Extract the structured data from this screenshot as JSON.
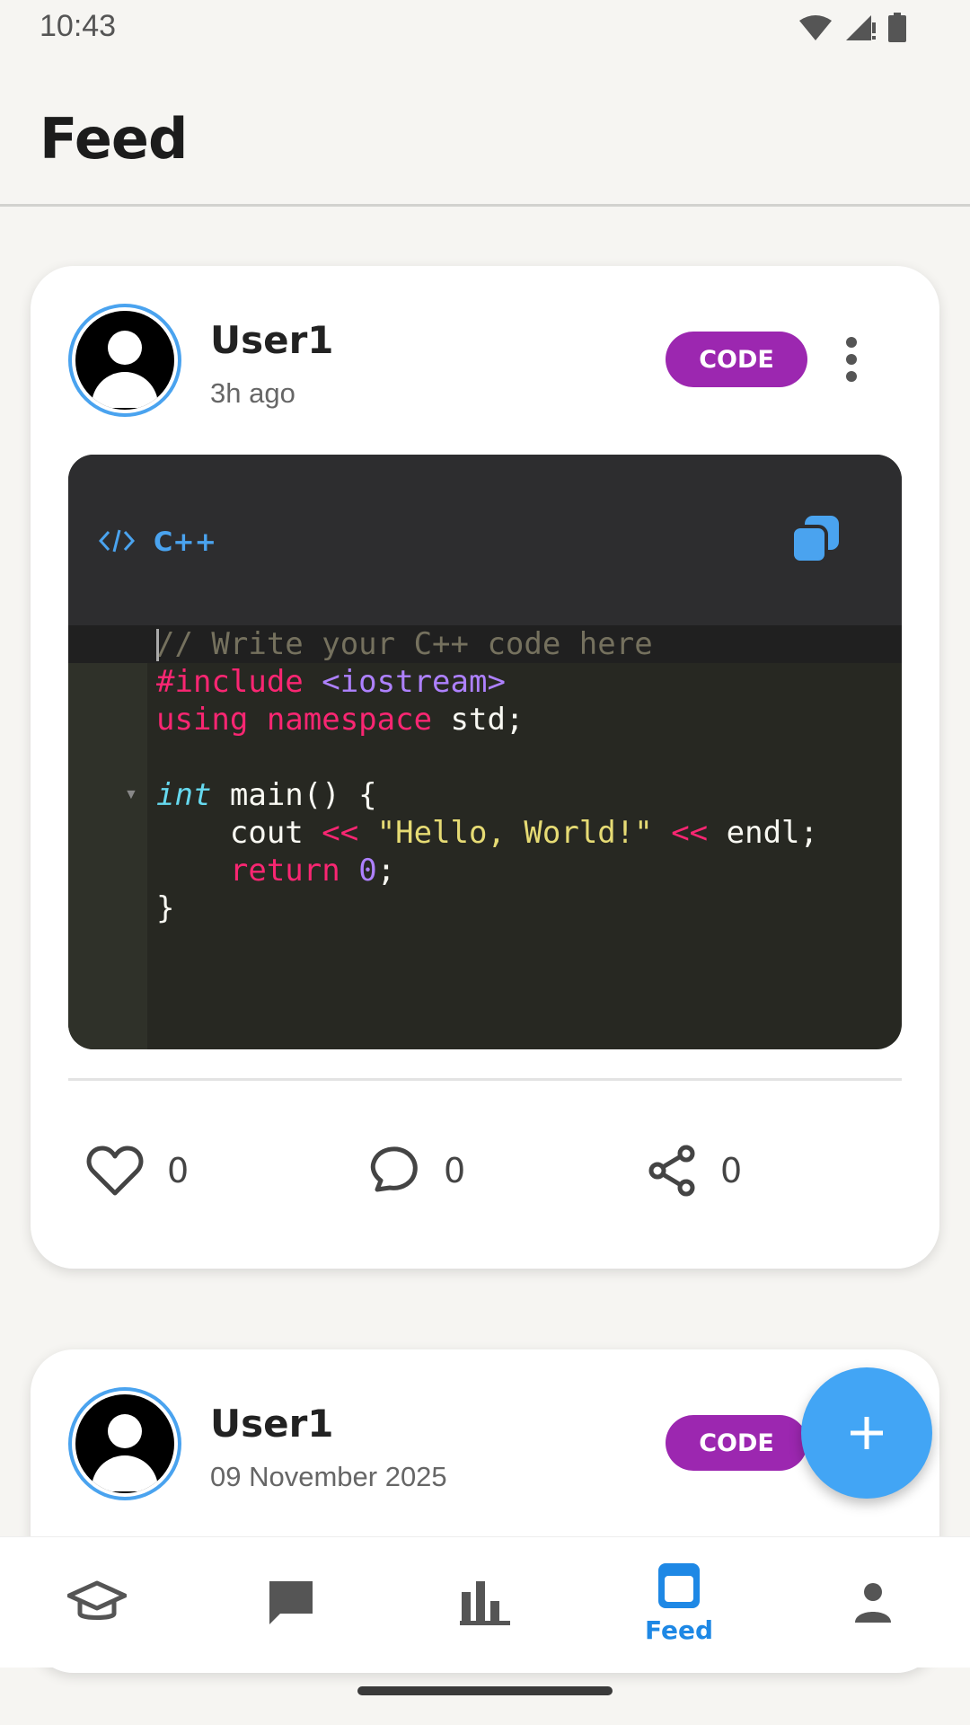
{
  "status_bar": {
    "time": "10:43",
    "icons": [
      "wifi-icon",
      "signal-icon",
      "battery-icon"
    ]
  },
  "header": {
    "title": "Feed"
  },
  "posts": [
    {
      "user": "User1",
      "time": "3h ago",
      "badge": "CODE",
      "language": "C++",
      "code_lines": [
        "// Write your C++ code here",
        "#include <iostream>",
        "using namespace std;",
        "",
        "int main() {",
        "    cout << \"Hello, World!\" << endl;",
        "    return 0;",
        "}"
      ],
      "likes": "0",
      "comments": "0",
      "shares": "0"
    },
    {
      "user": "User1",
      "time": "09 November 2025",
      "badge": "CODE"
    }
  ],
  "bottom_nav": {
    "items": [
      {
        "icon": "graduation-cap-icon",
        "label": ""
      },
      {
        "icon": "chat-icon",
        "label": ""
      },
      {
        "icon": "bar-chart-icon",
        "label": ""
      },
      {
        "icon": "feed-icon",
        "label": "Feed",
        "active": true
      },
      {
        "icon": "person-icon",
        "label": ""
      }
    ]
  },
  "colors": {
    "accent": "#42a5f5",
    "badge": "#9c27b0",
    "nav_active": "#1e88e5",
    "background": "#f6f5f2"
  }
}
